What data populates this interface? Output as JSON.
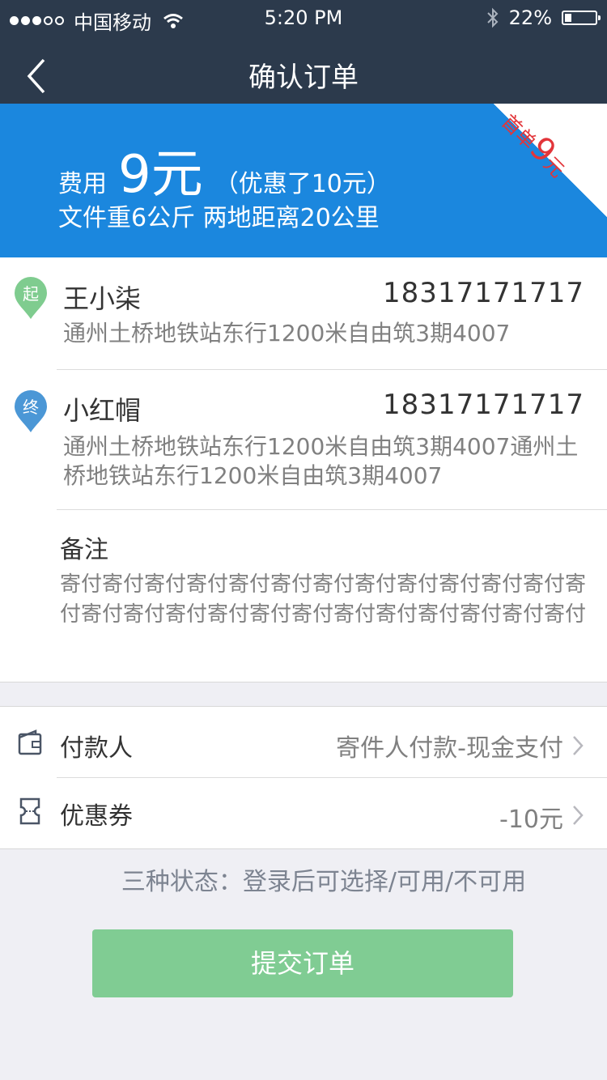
{
  "status_bar": {
    "carrier": "中国移动",
    "time": "5:20 PM",
    "battery": "22%",
    "battery_level": 0.22,
    "icons": [
      "signal-dots",
      "wifi-icon",
      "bluetooth-icon",
      "battery-icon"
    ]
  },
  "nav": {
    "title": "确认订单",
    "back_icon": "chevron-left-icon"
  },
  "fee": {
    "label": "费用",
    "amount": "9元",
    "discount": "（优惠了10元）",
    "info": "文件重6公斤  两地距离20公里",
    "corner_prefix": "首单",
    "corner_amount": "9",
    "corner_suffix": "元",
    "corner_color": "#e2353a",
    "bg_color": "#1b87de"
  },
  "sender": {
    "tag": "起",
    "name": "王小柒",
    "phone": "18317171717",
    "address": "通州土桥地铁站东行1200米自由筑3期4007",
    "tag_color": "#7fcc8f"
  },
  "receiver": {
    "tag": "终",
    "name": "小红帽",
    "phone": "18317171717",
    "address": "通州土桥地铁站东行1200米自由筑3期4007通州土桥地铁站东行1200米自由筑3期4007",
    "tag_color": "#4b97d6"
  },
  "remark": {
    "title": "备注",
    "text": "寄付寄付寄付寄付寄付寄付寄付寄付寄付寄付寄付寄付寄付寄付寄付寄付寄付寄付寄付寄付寄付寄付寄付寄付寄付"
  },
  "payment": {
    "payer_label": "付款人",
    "payer_value": "寄件人付款-现金支付",
    "coupon_label": "优惠券",
    "coupon_value": "-10元"
  },
  "hint": "三种状态：登录后可选择/可用/不可用",
  "submit_label": "提交订单",
  "submit_color": "#80cc93"
}
